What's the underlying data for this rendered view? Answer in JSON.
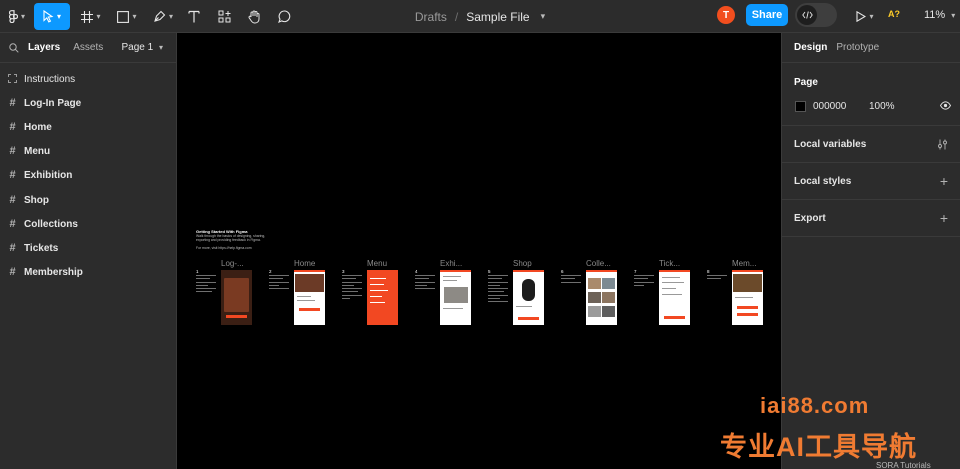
{
  "breadcrumb": {
    "drafts": "Drafts",
    "separator": "/",
    "file": "Sample File"
  },
  "toolbar": {
    "avatar_initial": "T",
    "share_label": "Share",
    "ai_label": "A?",
    "zoom": "11%"
  },
  "left": {
    "tabs": {
      "layers": "Layers",
      "assets": "Assets",
      "page": "Page 1"
    },
    "layers": [
      "Instructions",
      "Log-In Page",
      "Home",
      "Menu",
      "Exhibition",
      "Shop",
      "Collections",
      "Tickets",
      "Membership"
    ]
  },
  "canvas": {
    "intro_title": "Getting Started With Figma",
    "intro_body": "Walk through the basics of designing, sharing, exporting and providing feedback in Figma.",
    "intro_link": "For more, visit https://help.figma.com",
    "frames": [
      "Log-...",
      "Home",
      "Menu",
      "Exhi...",
      "Shop",
      "Colle...",
      "Tick...",
      "Mem..."
    ],
    "numbers": [
      "1",
      "2",
      "3",
      "4",
      "5",
      "6",
      "7",
      "8"
    ]
  },
  "right": {
    "tabs": {
      "design": "Design",
      "prototype": "Prototype"
    },
    "page_title": "Page",
    "bg_hex": "000000",
    "bg_opacity": "100%",
    "local_variables": "Local variables",
    "local_styles": "Local styles",
    "export": "Export"
  },
  "watermark": {
    "line1": "iai88.com",
    "line2": "专业AI工具导航",
    "line3": "SORA Tutorials"
  },
  "colors": {
    "accent": "#0d99ff",
    "avatar": "#f24e1e",
    "frame_red": "#f24822",
    "panel": "#2c2c2c"
  }
}
